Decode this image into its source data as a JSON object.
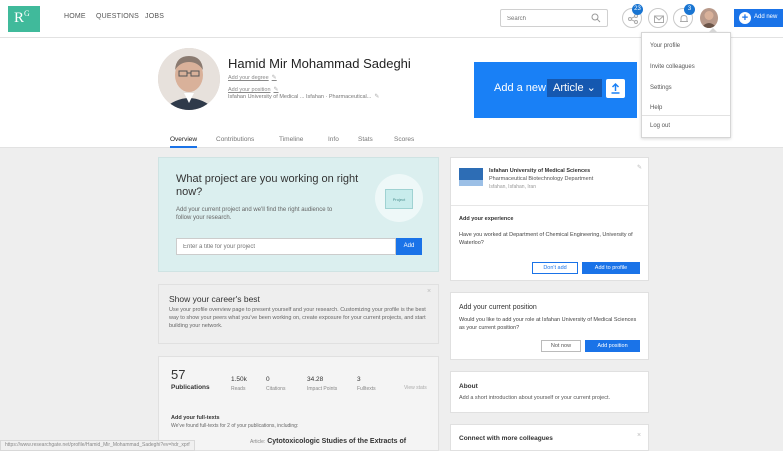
{
  "logo": {
    "text": "R",
    "sup": "G"
  },
  "nav": {
    "home": "HOME",
    "questions": "QUESTIONS",
    "jobs": "JOBS"
  },
  "search": {
    "placeholder": "Search"
  },
  "badges": {
    "requests": "23",
    "notifications": "3"
  },
  "addnew_button": "Add new",
  "profile": {
    "name": "Hamid Mir Mohammad Sadeghi",
    "degree_link": "Add your degree",
    "position_link": "Add your position",
    "institution": "Isfahan University of Medical ... Isfahan · Pharmaceutical..."
  },
  "addnew_banner": {
    "label": "Add a new",
    "selected": "Article"
  },
  "tabs": [
    "Overview",
    "Contributions",
    "Timeline",
    "Info",
    "Stats",
    "Scores"
  ],
  "menu": {
    "items": [
      "Your profile",
      "Invite colleagues",
      "Settings",
      "Help"
    ],
    "logout": "Log out"
  },
  "project": {
    "title": "What project are you working on right now?",
    "desc": "Add your current project and we'll find the right audience to follow your research.",
    "input_placeholder": "Enter a title for your project",
    "add": "Add",
    "folder_label": "Project"
  },
  "career": {
    "title": "Show your career's best",
    "desc": "Use your profile overview page to present yourself and your research. Customizing your profile is the best way to show your peers what you've been working on, create exposure for your current projects, and start building your network."
  },
  "stats": {
    "publications_count": "57",
    "publications_label": "Publications",
    "items": [
      {
        "value": "1.50k",
        "label": "Reads"
      },
      {
        "value": "0",
        "label": "Citations"
      },
      {
        "value": "34.28",
        "label": "Impact Points"
      },
      {
        "value": "3",
        "label": "Fulltexts"
      }
    ],
    "view_link": "View stats"
  },
  "fulltexts": {
    "title": "Add your full-texts",
    "desc": "We've found full-texts for 2 of your publications, including:",
    "article_prefix": "Article:",
    "pub_title": "Cytotoxicologic Studies of the Extracts of"
  },
  "institution": {
    "name": "Isfahan University of Medical Sciences",
    "dept": "Pharmaceutical Biotechnology Department",
    "location": "Isfahan, Isfahan, Iran"
  },
  "experience": {
    "title": "Add your experience",
    "desc": "Have you worked at Department of Chemical Engineering, University of Waterloo?",
    "dont_add": "Don't add",
    "add_profile": "Add to profile"
  },
  "position": {
    "title": "Add your current position",
    "desc": "Would you like to add your role at Isfahan University of Medical Sciences as your current position?",
    "not_now": "Not now",
    "add_position": "Add position"
  },
  "about": {
    "title": "About",
    "desc": "Add a short introduction about yourself or your current project."
  },
  "connect": {
    "title": "Connect with more colleagues"
  },
  "status_url": "https://www.researchgate.net/profile/Hamid_Mir_Mohammad_Sadeghi?ev=hdr_xprf",
  "colors": {
    "accent": "#1a73e8",
    "logo": "#40ba9b",
    "project_bg": "#dbefef"
  }
}
